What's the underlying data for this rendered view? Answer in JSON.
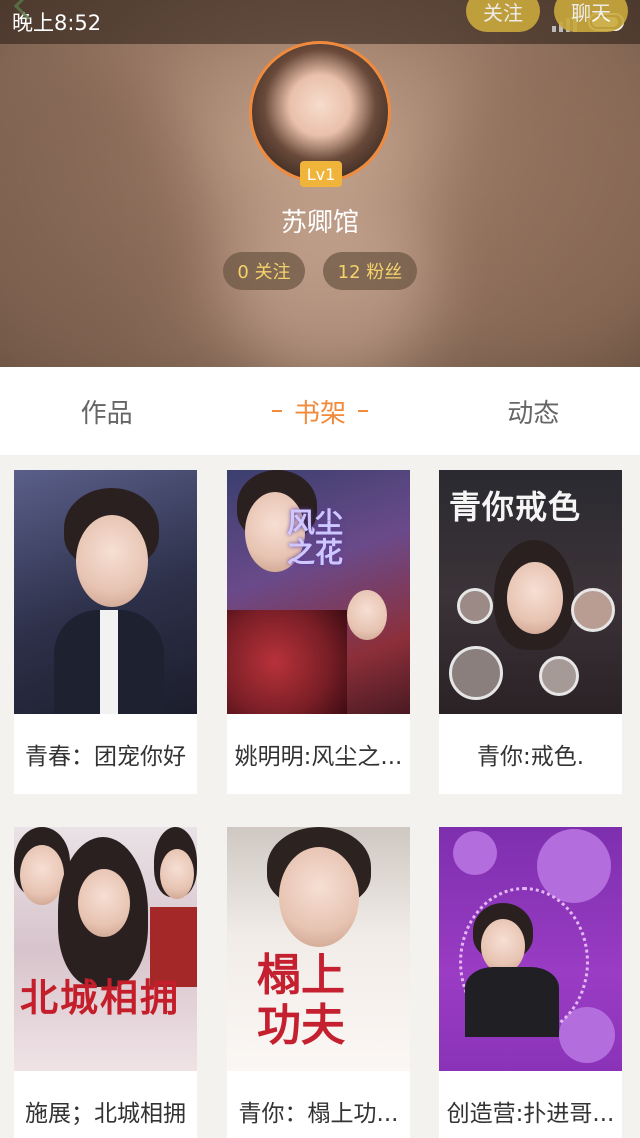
{
  "status_bar": {
    "time": "晚上8:52"
  },
  "header": {
    "follow_label": "关注",
    "chat_label": "聊天",
    "level": "Lv1",
    "username": "苏卿馆",
    "following": "0 关注",
    "fans": "12 粉丝"
  },
  "tabs": [
    {
      "label": "作品",
      "active": false
    },
    {
      "label": "书架",
      "active": true
    },
    {
      "label": "动态",
      "active": false
    }
  ],
  "books": [
    {
      "title": "青春：团宠你好",
      "cover_text": ""
    },
    {
      "title": "姚明明:风尘之...",
      "cover_text": "风尘之花"
    },
    {
      "title": "青你:戒色.",
      "cover_text": "青你戒色"
    },
    {
      "title": "施展；北城相拥",
      "cover_text": "北城相拥"
    },
    {
      "title": "青你：榻上功...",
      "cover_text": "榻上功夫"
    },
    {
      "title": "创造营:扑进哥...",
      "cover_text": ""
    }
  ],
  "colors": {
    "accent": "#f28a3c",
    "badge": "#f0b43a",
    "stat_text": "#f5d36a"
  }
}
